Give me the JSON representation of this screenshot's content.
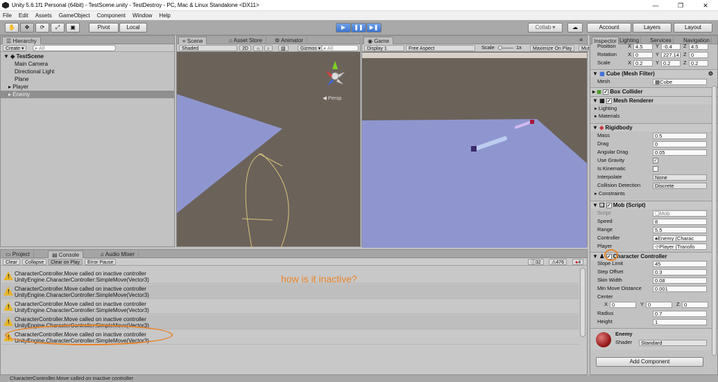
{
  "window": {
    "title": "Unity 5.6.1f1 Personal (64bit) - TestScene.unity - TestDestroy - PC, Mac & Linux Standalone <DX11>",
    "min": "—",
    "max": "❐",
    "close": "✕"
  },
  "menu": [
    "File",
    "Edit",
    "Assets",
    "GameObject",
    "Component",
    "Window",
    "Help"
  ],
  "toolbar": {
    "pivot": "Pivot",
    "local": "Local",
    "collab": "Collab ▾",
    "account": "Account",
    "layers": "Layers",
    "layout": "Layout",
    "play": "▶",
    "pause": "❚❚",
    "step": "▶❚"
  },
  "hierarchy": {
    "tab": "Hierarchy",
    "create": "Create ▾",
    "search_placeholder": "All",
    "scene": "TestScene",
    "items": [
      "Main Camera",
      "Directional Light",
      "Plane",
      "Player",
      "Enemy"
    ]
  },
  "scene": {
    "tabs": [
      "Scene",
      "Asset Store",
      "Animator"
    ],
    "shaded": "Shaded",
    "mode2d": "2D",
    "gizmos": "Gizmos ▾",
    "search_placeholder": "All",
    "persp": "Persp"
  },
  "game": {
    "tab": "Game",
    "display": "Display 1",
    "aspect": "Free Aspect",
    "scale": "Scale",
    "scale_value": "1x",
    "maximize": "Maximize On Play",
    "mute": "Mute"
  },
  "console": {
    "tabs": [
      "Project",
      "Console",
      "Audio Mixer"
    ],
    "clear": "Clear",
    "collapse": "Collapse",
    "clear_on_play": "Clear on Play",
    "error_pause": "Error Pause",
    "count_info": "32",
    "count_warn": "476",
    "count_error": "4",
    "logs": [
      [
        "CharacterController.Move called on inactive controller",
        "UnityEngine.CharacterController:SimpleMove(Vector3)"
      ],
      [
        "CharacterController.Move called on inactive controller",
        "UnityEngine.CharacterController:SimpleMove(Vector3)"
      ],
      [
        "CharacterController.Move called on inactive controller",
        "UnityEngine.CharacterController:SimpleMove(Vector3)"
      ],
      [
        "CharacterController.Move called on inactive controller",
        "UnityEngine.CharacterController:SimpleMove(Vector3)"
      ],
      [
        "CharacterController.Move called on inactive controller",
        "UnityEngine.CharacterController:SimpleMove(Vector3)"
      ]
    ],
    "annotation": "how is it inactive?"
  },
  "status": {
    "text": "CharacterController.Move called on inactive controller"
  },
  "inspector": {
    "tabs": [
      "Inspector",
      "Lighting",
      "Services",
      "Navigation"
    ],
    "transform": {
      "position": "Position",
      "rotation": "Rotation",
      "scale": "Scale",
      "pos": [
        "4.5",
        "-0.4",
        "4.5"
      ],
      "rot": [
        "0",
        "227.14",
        "0"
      ],
      "scl": [
        "0.2",
        "0.2",
        "0.2"
      ]
    },
    "mesh_filter": {
      "title": "Cube (Mesh Filter)",
      "mesh_label": "Mesh",
      "mesh_value": "Cube"
    },
    "box_collider": {
      "title": "Box Collider"
    },
    "mesh_renderer": {
      "title": "Mesh Renderer",
      "lighting": "Lighting",
      "materials": "Materials"
    },
    "rigidbody": {
      "title": "Rigidbody",
      "mass": "Mass",
      "mass_v": "0.5",
      "drag": "Drag",
      "drag_v": "0",
      "adrag": "Angular Drag",
      "adrag_v": "0.05",
      "gravity": "Use Gravity",
      "kinematic": "Is Kinematic",
      "interp": "Interpolate",
      "interp_v": "None",
      "coll": "Collision Detection",
      "coll_v": "Discrete",
      "constraints": "Constraints"
    },
    "mob": {
      "title": "Mob (Script)",
      "script": "Script",
      "script_v": "Mob",
      "speed": "Speed",
      "speed_v": "8",
      "range": "Range",
      "range_v": "5.5",
      "controller": "Controller",
      "controller_v": "Enemy (Charac",
      "player": "Player",
      "player_v": "Player (Transfo"
    },
    "cc": {
      "title": "Character Controller",
      "slope": "Slope Limit",
      "slope_v": "45",
      "step": "Step Offset",
      "step_v": "0.3",
      "skin": "Skin Width",
      "skin_v": "0.08",
      "minmove": "Min Move Distance",
      "minmove_v": "0.001",
      "center": "Center",
      "center_v": [
        "0",
        "0",
        "0"
      ],
      "radius": "Radius",
      "radius_v": "0.7",
      "height": "Height",
      "height_v": "1"
    },
    "material": {
      "name": "Enemy",
      "shader": "Shader",
      "shader_v": "Standard"
    },
    "add_component": "Add Component"
  },
  "colors": {
    "accent": "#e8842a",
    "play": "#3c74d0",
    "plane": "#8f96cf",
    "ground": "#6b625a"
  }
}
